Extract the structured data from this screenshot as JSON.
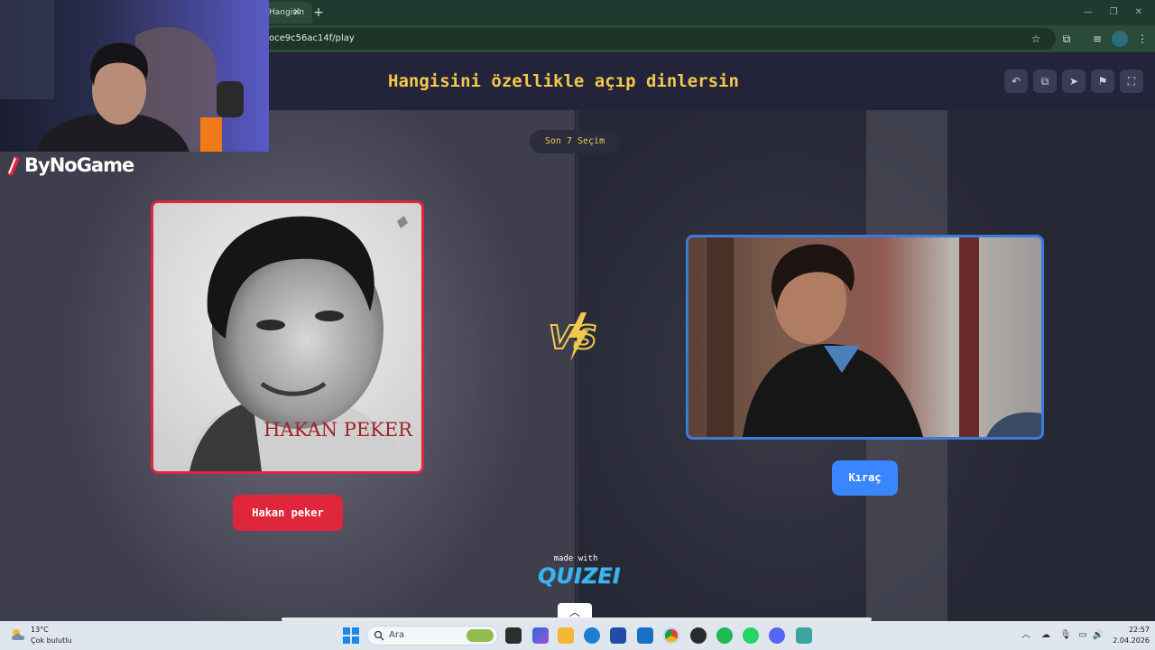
{
  "browser": {
    "tab_title": "Hangisin",
    "url": "oce9c56ac14f/play",
    "new_tab_symbol": "+",
    "tab_close_symbol": "×"
  },
  "page": {
    "title": "Hangisini özellikle açıp dinlersin",
    "round_chip": "Son 7 Seçim",
    "header_buttons": [
      "undo-icon",
      "copy-icon",
      "send-icon",
      "flag-icon",
      "fullscreen-icon"
    ],
    "colors": {
      "accent_yellow": "#f2c94c",
      "left_red": "#e0263a",
      "right_blue": "#3a86ff",
      "header_bg": "#23243a"
    }
  },
  "overlay": {
    "logo_text": "ByNoGame"
  },
  "choices": {
    "left": {
      "photo_caption": "HAKAN PEKER",
      "label": "Hakan peker"
    },
    "right": {
      "label": "Kıraç"
    }
  },
  "footer": {
    "made_with": "made with",
    "brand": "QUIZEI"
  },
  "taskbar": {
    "weather_temp": "13°C",
    "weather_desc": "Çok bulutlu",
    "search_placeholder": "Ara",
    "time": "22:57",
    "date": "2.04.2026"
  }
}
